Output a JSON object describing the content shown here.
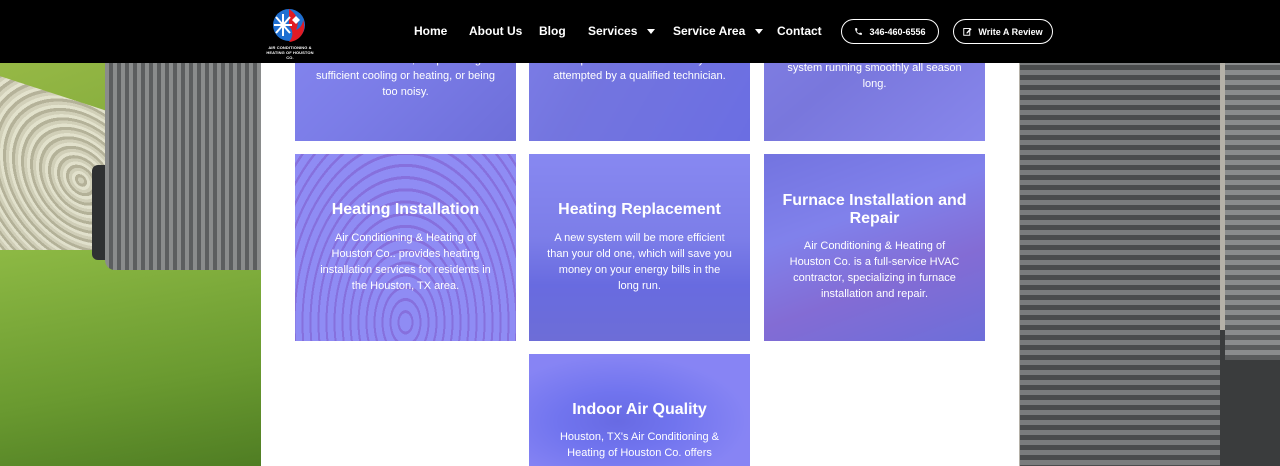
{
  "brand": {
    "logo_text": "AIR CONDITIONING & HEATING OF HOUSTON CO.",
    "colors": {
      "red": "#e21b23",
      "blue": "#1f6fd1",
      "card_tint": "#7979f6",
      "header_bg": "#000000"
    }
  },
  "nav": {
    "home": "Home",
    "about": "About Us",
    "blog": "Blog",
    "services": "Services",
    "service_area": "Service Area",
    "contact": "Contact",
    "phone": "346-460-6556",
    "review": "Write A Review",
    "icons": {
      "phone": "phone-icon",
      "review": "edit-icon",
      "dropdown": "chevron-down-icon"
    }
  },
  "cards_top": [
    {
      "text": "old and outdated, not providing sufficient cooling or heating, or being too noisy."
    },
    {
      "text": "complex task that should only be attempted by a qualified technician."
    },
    {
      "text": "system running smoothly all season long."
    }
  ],
  "cards": [
    {
      "title": "Heating Installation",
      "text": "Air Conditioning & Heating of Houston Co.. provides heating installation services for residents in the Houston, TX area."
    },
    {
      "title": "Heating Replacement",
      "text": "A new system will be more efficient than your old one, which will save you money on your energy bills in the long run."
    },
    {
      "title": "Furnace Installation and Repair",
      "text": "Air Conditioning & Heating of Houston Co. is a full-service HVAC contractor, specializing in furnace installation and repair."
    },
    {
      "title": "Indoor Air Quality",
      "text": "Houston, TX's Air Conditioning & Heating of Houston Co. offers"
    }
  ]
}
